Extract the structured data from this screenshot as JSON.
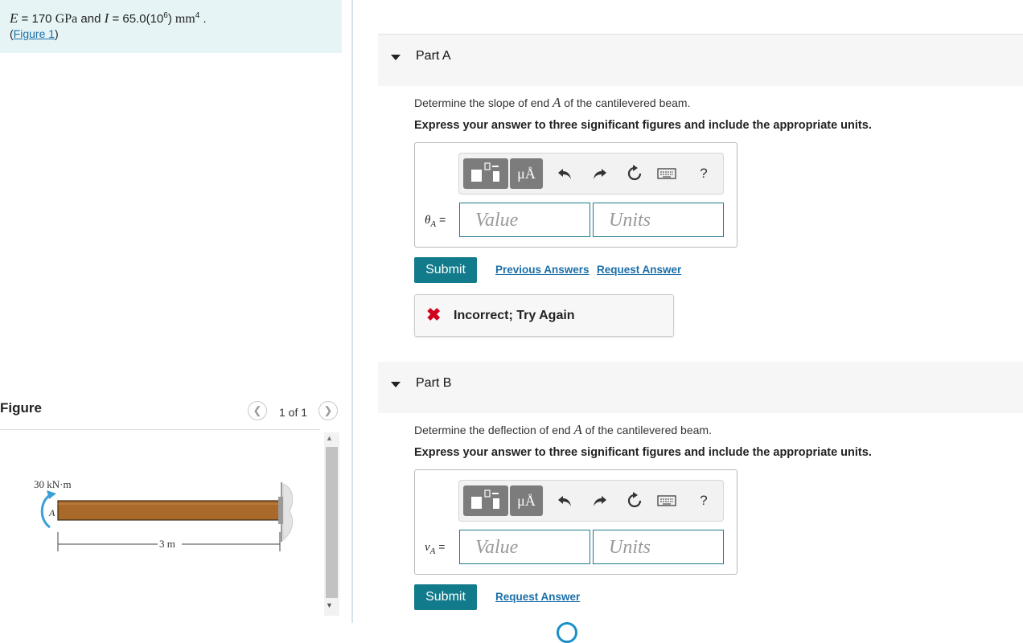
{
  "given": {
    "e_symbol": "E",
    "e_eq": " = 170 ",
    "e_unit": "GPa",
    "and": " and ",
    "i_symbol": "I",
    "i_eq": " = 65.0(10",
    "i_exp": "6",
    "i_close": ")",
    "i_unit": " mm",
    "i_unit_exp": "4",
    "period": " .",
    "figure_link_open": "(",
    "figure_link": "Figure 1",
    "figure_link_close": ")"
  },
  "figure": {
    "title": "Figure",
    "counter": "1 of 1",
    "moment_label": "30 kN·m",
    "point_label": "A",
    "length_label": "3 m",
    "beam_color": "#a8692a",
    "moment_color": "#3aa0d8"
  },
  "part_a": {
    "label": "Part A",
    "question_pre": "Determine the slope of end ",
    "question_var": "A",
    "question_post": " of the cantilevered beam.",
    "instruction": "Express your answer to three significant figures and include the appropriate units.",
    "answer_symbol": "θ",
    "answer_sub": "A",
    "answer_eq": " =",
    "value_placeholder": "Value",
    "units_placeholder": "Units",
    "submit": "Submit",
    "previous_answers": "Previous Answers",
    "request_answer": "Request Answer",
    "feedback_icon": "✖",
    "feedback": "Incorrect; Try Again"
  },
  "part_b": {
    "label": "Part B",
    "question_pre": "Determine the deflection of end ",
    "question_var": "A",
    "question_post": " of the cantilevered beam.",
    "instruction": "Express your answer to three significant figures and include the appropriate units.",
    "answer_symbol": "v",
    "answer_sub": "A",
    "answer_eq": " =",
    "value_placeholder": "Value",
    "units_placeholder": "Units",
    "submit": "Submit",
    "request_answer": "Request Answer"
  },
  "toolbar": {
    "mu_label": "μÅ",
    "help_label": "?",
    "icons": [
      "templates-icon",
      "units-icon",
      "undo-icon",
      "redo-icon",
      "reset-icon",
      "keyboard-icon",
      "help-icon"
    ]
  },
  "colors": {
    "accent": "#117a8b",
    "link": "#1b6fa8",
    "error": "#d0021b",
    "given_bg": "#e6f4f5"
  }
}
